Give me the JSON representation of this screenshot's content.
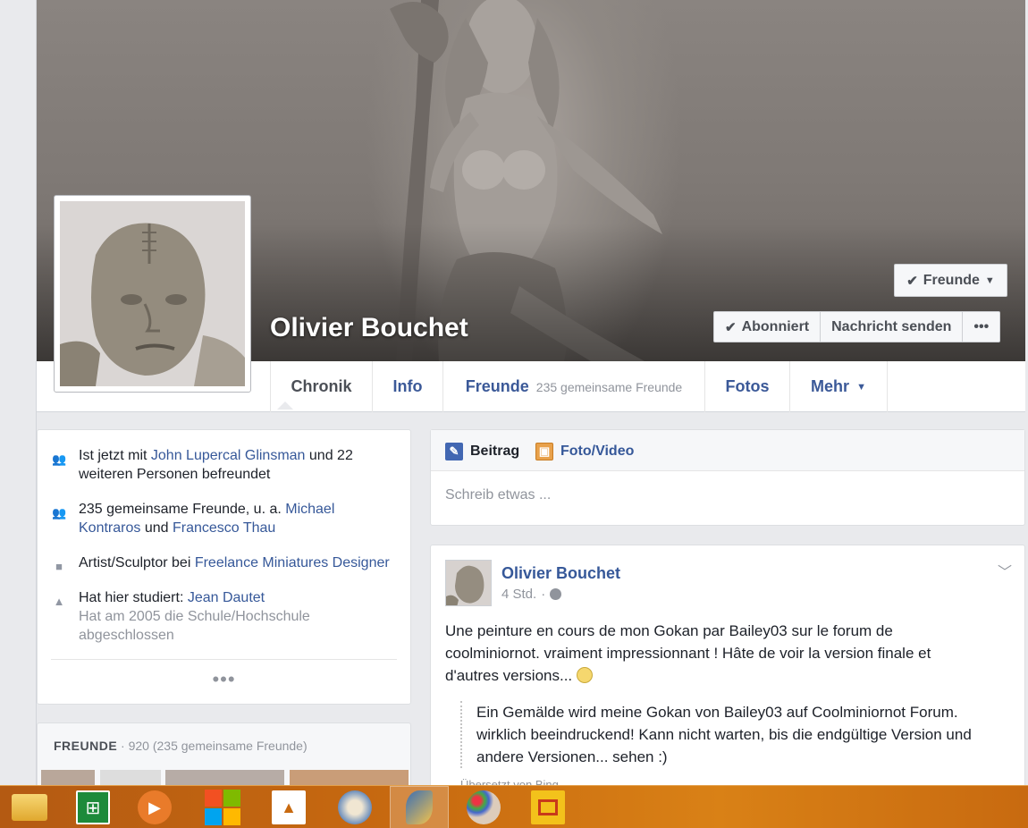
{
  "profile": {
    "name": "Olivier Bouchet",
    "buttons": {
      "friends": "Freunde",
      "subscribed": "Abonniert",
      "message": "Nachricht senden",
      "more": "•••"
    }
  },
  "nav": {
    "tabs": [
      {
        "label": "Chronik"
      },
      {
        "label": "Info"
      },
      {
        "label": "Freunde",
        "sub": "235 gemeinsame Freunde"
      },
      {
        "label": "Fotos"
      },
      {
        "label": "Mehr"
      }
    ]
  },
  "intro": {
    "item1": {
      "pre": "Ist jetzt mit ",
      "link": "John Lupercal Glinsman",
      "post": " und 22 weiteren Personen befreundet"
    },
    "item2": {
      "pre": "235 gemeinsame Freunde, u. a. ",
      "link1": "Michael Kontraros",
      "mid": " und ",
      "link2": "Francesco Thau"
    },
    "item3": {
      "pre": "Artist/Sculptor bei ",
      "link": "Freelance Miniatures Designer"
    },
    "item4": {
      "pre": "Hat hier studiert: ",
      "link": "Jean Dautet",
      "sub": "Hat am 2005 die Schule/Hochschule abgeschlossen"
    },
    "more": "•••"
  },
  "friends_box": {
    "title": "FREUNDE",
    "count": " · 920 (235 gemeinsame Freunde)"
  },
  "composer": {
    "tab_post": "Beitrag",
    "tab_photo": "Foto/Video",
    "placeholder": "Schreib etwas ..."
  },
  "post": {
    "author": "Olivier Bouchet",
    "time": "4 Std.",
    "separator": "·",
    "text": "Une peinture en cours de mon Gokan par Bailey03 sur le forum de coolminiornot. vraiment impressionnant ! Hâte de voir la version finale et d'autres versions...",
    "translation": "Ein Gemälde wird meine Gokan von Bailey03 auf Coolminiornot Forum. wirklich beeindruckend! Kann nicht warten, bis die endgültige Version und andere Versionen... sehen :)",
    "translation_note": "Übersetzt von Bing"
  },
  "taskbar": {
    "icons": [
      "file-explorer-icon",
      "store-icon",
      "media-player-icon",
      "windows-logo-icon",
      "app-icon",
      "paint-tools-icon",
      "artrage-icon",
      "paint-palette-icon",
      "slideshow-icon"
    ],
    "colors": {
      "bar": "#c86a10",
      "accent": "#3b5998"
    }
  }
}
